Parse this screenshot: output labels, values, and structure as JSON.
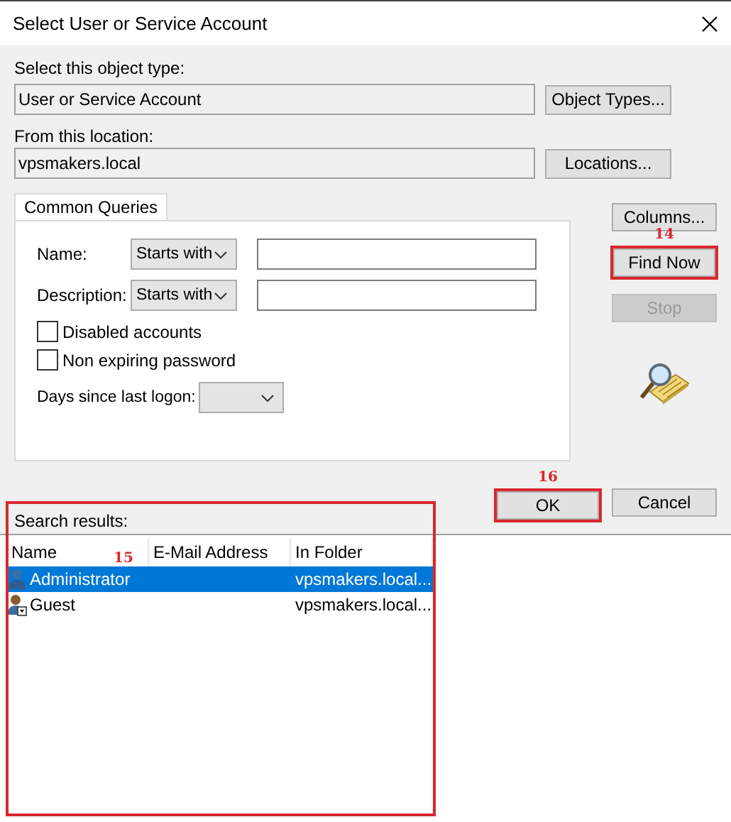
{
  "window": {
    "title": "Select User or Service Account"
  },
  "object_type": {
    "label": "Select this object type:",
    "value": "User or Service Account",
    "button": "Object Types..."
  },
  "location": {
    "label": "From this location:",
    "value": "vpsmakers.local",
    "button": "Locations..."
  },
  "tabs": [
    {
      "label": "Common Queries",
      "selected": true
    }
  ],
  "query_fields": [
    {
      "label": "Name:",
      "operator": "Starts with"
    },
    {
      "label": "Description:",
      "operator": "Starts with"
    }
  ],
  "checkboxes": [
    {
      "label": "Disabled accounts",
      "checked": false
    },
    {
      "label": "Non expiring password",
      "checked": false
    }
  ],
  "days_since_logon": {
    "label": "Days since last logon:"
  },
  "side_buttons": [
    {
      "label": "Columns...",
      "disabled": false
    },
    {
      "label": "Find Now",
      "disabled": false,
      "callout": "14"
    },
    {
      "label": "Stop",
      "disabled": true
    }
  ],
  "dialog_buttons": [
    {
      "label": "OK",
      "callout": "16"
    },
    {
      "label": "Cancel"
    }
  ],
  "results": {
    "label": "Search results:",
    "callout": "15",
    "columns": [
      "Name",
      "E-Mail Address",
      "In Folder"
    ],
    "rows": [
      {
        "kind": "admin",
        "name": "Administrator",
        "folder": "vpsmakers.local...",
        "selected": true
      },
      {
        "kind": "guest",
        "name": "Guest",
        "folder": "vpsmakers.local...",
        "selected": false
      }
    ]
  }
}
